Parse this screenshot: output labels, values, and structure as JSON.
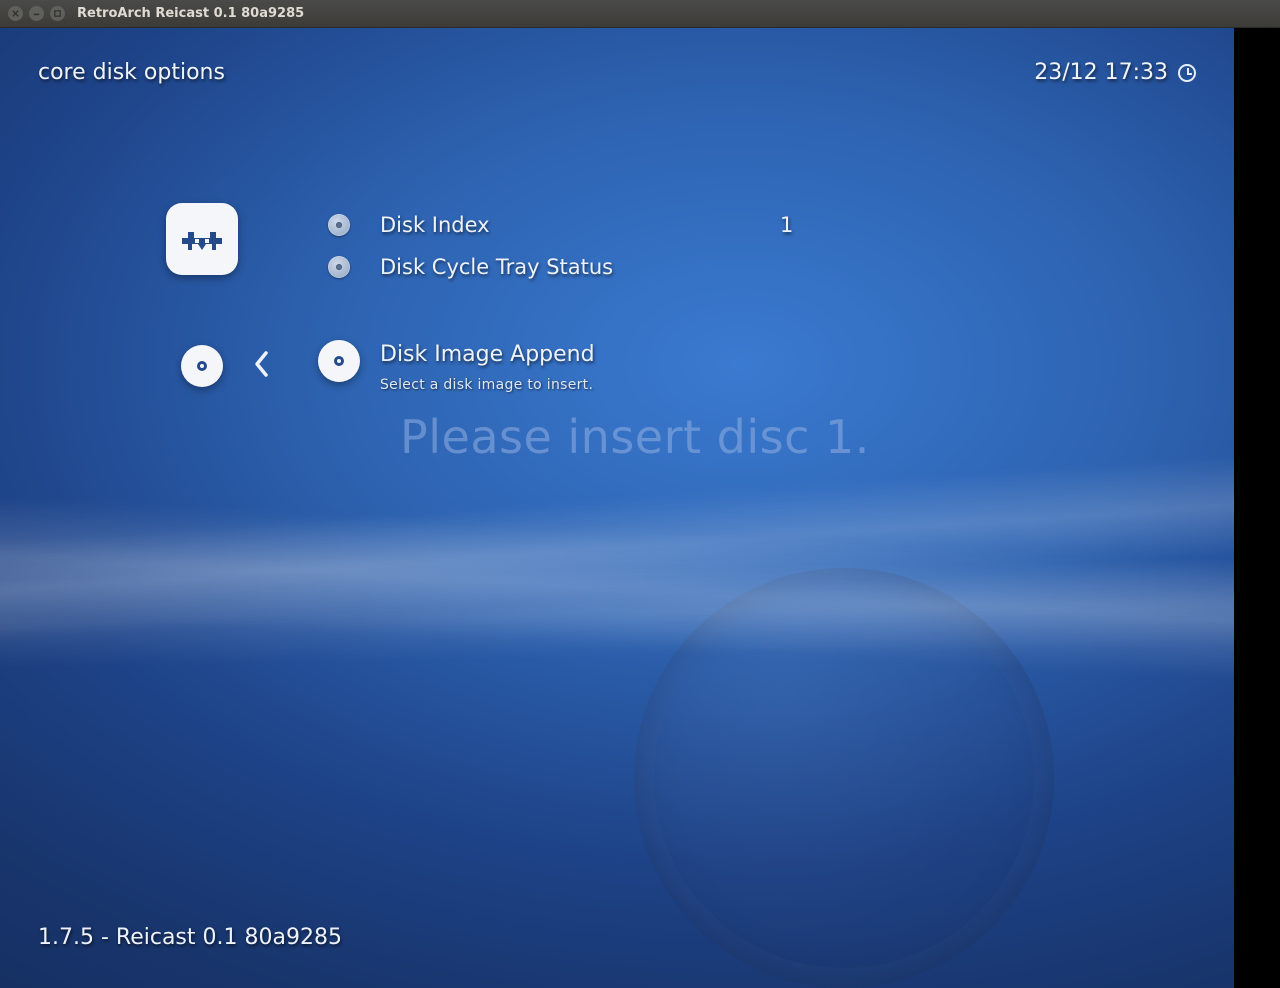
{
  "window": {
    "title": "RetroArch Reicast 0.1 80a9285"
  },
  "header": {
    "breadcrumb": "core disk options",
    "datetime": "23/12 17:33"
  },
  "menu": {
    "items": [
      {
        "label": "Disk Index",
        "value": "1"
      },
      {
        "label": "Disk Cycle Tray Status",
        "value": ""
      }
    ],
    "selected": {
      "label": "Disk Image Append",
      "description": "Select a disk image to insert."
    }
  },
  "overlay": {
    "message": "Please insert disc 1."
  },
  "footer": {
    "version": "1.7.5 - Reicast 0.1 80a9285"
  }
}
